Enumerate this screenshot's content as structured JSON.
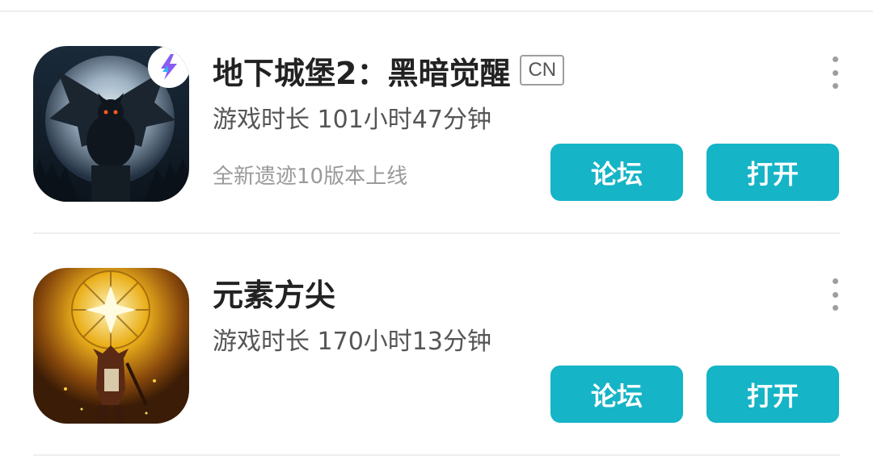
{
  "games": [
    {
      "title": "地下城堡2：黑暗觉醒",
      "region_badge": "CN",
      "playtime": "游戏时长 101小时47分钟",
      "update_note": "全新遗迹10版本上线",
      "forum_label": "论坛",
      "open_label": "打开",
      "icon": "gargoyle-moon-icon",
      "has_speed_badge": true
    },
    {
      "title": "元素方尖",
      "playtime": "游戏时长 170小时13分钟",
      "forum_label": "论坛",
      "open_label": "打开",
      "icon": "obelisk-star-icon"
    }
  ],
  "colors": {
    "button": "#15b4c6",
    "title": "#222222",
    "subtitle": "#555555",
    "muted": "#9a9a9a",
    "divider": "#eeeeee"
  }
}
